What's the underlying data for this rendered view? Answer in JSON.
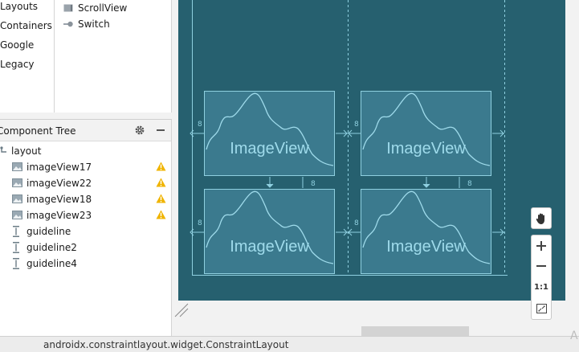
{
  "palette": {
    "categories": [
      "Layouts",
      "Containers",
      "Google",
      "Legacy"
    ],
    "items": [
      "ScrollView",
      "Switch"
    ]
  },
  "component_tree": {
    "title": "Component Tree",
    "root": "layout",
    "nodes": [
      {
        "label": "imageView17",
        "type": "image",
        "warning": true
      },
      {
        "label": "imageView22",
        "type": "image",
        "warning": true
      },
      {
        "label": "imageView18",
        "type": "image",
        "warning": true
      },
      {
        "label": "imageView23",
        "type": "image",
        "warning": true
      },
      {
        "label": "guideline",
        "type": "guideline",
        "warning": false
      },
      {
        "label": "guideline2",
        "type": "guideline",
        "warning": false
      },
      {
        "label": "guideline4",
        "type": "guideline",
        "warning": false
      }
    ]
  },
  "blueprint": {
    "image_view_label": "ImageView",
    "margin_label": "8"
  },
  "zoom": {
    "reset_label": "1:1"
  },
  "status": {
    "text": "androidx.constraintlayout.widget.ConstraintLayout",
    "corner_text": "A"
  },
  "colors": {
    "blueprint_bg": "#26606f",
    "widget_fill": "#3b7a8e",
    "line": "#8fd0e0",
    "warning": "#f0b400"
  }
}
